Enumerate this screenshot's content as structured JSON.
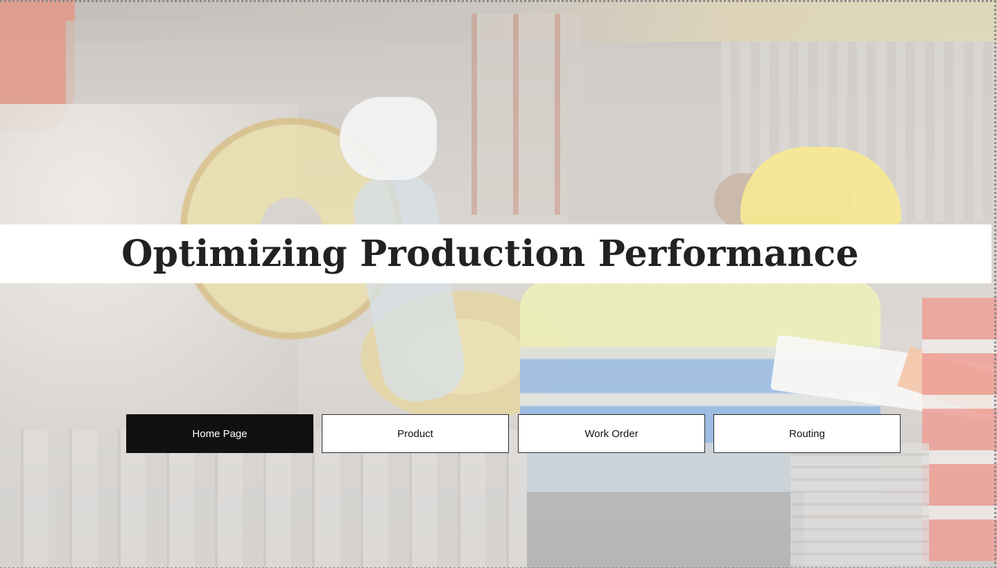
{
  "page": {
    "title": "Optimizing Production Performance"
  },
  "background": {
    "image": "factory-worker-hero",
    "accent_helmet_color": "#f2df6a",
    "vest_colors": [
      "#e4e9a2",
      "#6e9ed9"
    ]
  },
  "nav": {
    "active_index": 0,
    "active_color": "#111111",
    "buttons": [
      {
        "label": "Home Page"
      },
      {
        "label": "Product"
      },
      {
        "label": "Work Order"
      },
      {
        "label": "Routing"
      }
    ]
  }
}
